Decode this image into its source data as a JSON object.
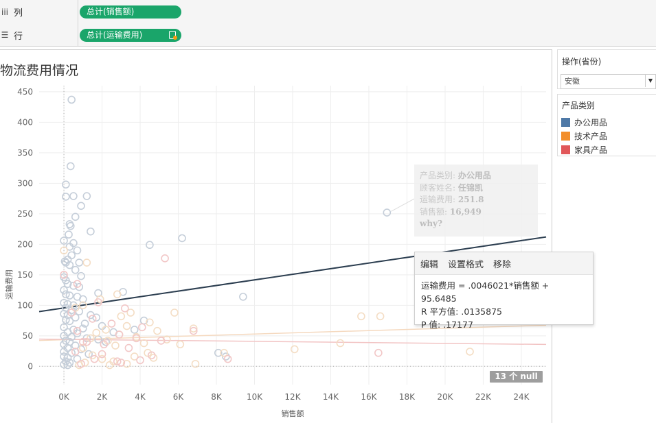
{
  "shelves": {
    "columns": {
      "icon": "columns-icon",
      "label": "列",
      "pill": "总计(销售额)"
    },
    "rows": {
      "icon": "rows-icon",
      "label": "行",
      "pill": "总计(运输费用)",
      "pill_icon": "trend-line-icon"
    }
  },
  "sheet_title": "物流费用情况",
  "filter": {
    "title": "操作(省份)",
    "value": "安徽"
  },
  "legend": {
    "title": "产品类别",
    "items": [
      {
        "label": "办公用品",
        "color": "#4e79a7"
      },
      {
        "label": "技术产品",
        "color": "#f28e2b"
      },
      {
        "label": "家具产品",
        "color": "#e15759"
      }
    ]
  },
  "faded_tooltip": {
    "l1_label": "产品类别:",
    "l1_value": "办公用品",
    "l2_label": "顾客姓名:",
    "l2_value": "任锦凯",
    "l3_label": "运输费用:",
    "l3_value": "251.8",
    "l4_label": "销售额:",
    "l4_value": "16,949",
    "l5": "why?"
  },
  "trend_menu": {
    "actions": [
      "编辑",
      "设置格式",
      "移除"
    ],
    "equation": "运输费用 = .0046021*销售额 + 95.6485",
    "r_squared": "R 平方值: .0135875",
    "p_value": "P 值: .17177"
  },
  "null_badge": "13 个 null",
  "chart_data": {
    "type": "scatter",
    "title": "物流费用情况",
    "xlabel": "销售额",
    "ylabel": "运输费用",
    "xlim": [
      -1300,
      25300
    ],
    "ylim": [
      -30,
      460
    ],
    "x_ticks": [
      0,
      2000,
      4000,
      6000,
      8000,
      10000,
      12000,
      14000,
      16000,
      18000,
      20000,
      22000,
      24000
    ],
    "x_tick_labels": [
      "0K",
      "2K",
      "4K",
      "6K",
      "8K",
      "10K",
      "12K",
      "14K",
      "16K",
      "18K",
      "20K",
      "22K",
      "24K"
    ],
    "y_ticks": [
      0,
      50,
      100,
      150,
      200,
      250,
      300,
      350,
      400,
      450
    ],
    "y_tick_labels": [
      "0",
      "50",
      "100",
      "150",
      "200",
      "250",
      "300",
      "350",
      "400",
      "450"
    ],
    "grid": true,
    "highlighted_point": {
      "series": "办公用品",
      "x": 16949,
      "y": 251.8
    },
    "trend_lines": [
      {
        "series": "办公用品",
        "slope": 0.0046021,
        "intercept": 95.6485,
        "color": "#2c3e50",
        "highlighted": true
      },
      {
        "series": "技术产品",
        "slope": 0.00094,
        "intercept": 43.5,
        "color": "#f5d9bf",
        "highlighted": false
      },
      {
        "series": "家具产品",
        "slope": -0.00033,
        "intercept": 44.2,
        "color": "#f2c4c4",
        "highlighted": false
      }
    ],
    "series": [
      {
        "name": "办公用品",
        "color": "#c5ced9",
        "points": [
          [
            400,
            437
          ],
          [
            350,
            328
          ],
          [
            100,
            298
          ],
          [
            100,
            278
          ],
          [
            500,
            279
          ],
          [
            1200,
            279
          ],
          [
            900,
            263
          ],
          [
            600,
            245
          ],
          [
            300,
            233
          ],
          [
            350,
            230
          ],
          [
            1400,
            221
          ],
          [
            250,
            216
          ],
          [
            0,
            206
          ],
          [
            500,
            202
          ],
          [
            300,
            196
          ],
          [
            700,
            190
          ],
          [
            400,
            182
          ],
          [
            200,
            175
          ],
          [
            50,
            172
          ],
          [
            100,
            170
          ],
          [
            800,
            170
          ],
          [
            300,
            166
          ],
          [
            600,
            158
          ],
          [
            0,
            146
          ],
          [
            100,
            141
          ],
          [
            900,
            148
          ],
          [
            200,
            135
          ],
          [
            500,
            132
          ],
          [
            800,
            130
          ],
          [
            0,
            125
          ],
          [
            100,
            118
          ],
          [
            300,
            116
          ],
          [
            700,
            114
          ],
          [
            1000,
            110
          ],
          [
            0,
            104
          ],
          [
            200,
            102
          ],
          [
            500,
            100
          ],
          [
            100,
            96
          ],
          [
            400,
            92
          ],
          [
            800,
            90
          ],
          [
            0,
            86
          ],
          [
            200,
            84
          ],
          [
            1400,
            84
          ],
          [
            600,
            80
          ],
          [
            1700,
            80
          ],
          [
            100,
            76
          ],
          [
            300,
            74
          ],
          [
            1100,
            70
          ],
          [
            2000,
            66
          ],
          [
            0,
            64
          ],
          [
            500,
            60
          ],
          [
            1000,
            62
          ],
          [
            3700,
            60
          ],
          [
            200,
            56
          ],
          [
            700,
            54
          ],
          [
            2600,
            56
          ],
          [
            0,
            50
          ],
          [
            400,
            48
          ],
          [
            1200,
            46
          ],
          [
            100,
            42
          ],
          [
            300,
            40
          ],
          [
            1800,
            44
          ],
          [
            2200,
            40
          ],
          [
            0,
            36
          ],
          [
            600,
            34
          ],
          [
            200,
            30
          ],
          [
            900,
            28
          ],
          [
            0,
            24
          ],
          [
            400,
            22
          ],
          [
            1300,
            20
          ],
          [
            0,
            16
          ],
          [
            200,
            14
          ],
          [
            700,
            12
          ],
          [
            100,
            8
          ],
          [
            300,
            6
          ],
          [
            0,
            3
          ],
          [
            200,
            2
          ],
          [
            4500,
            199
          ],
          [
            6200,
            210
          ],
          [
            9400,
            114
          ],
          [
            3100,
            122
          ],
          [
            1800,
            120
          ],
          [
            4200,
            75
          ],
          [
            16949,
            252
          ],
          [
            8100,
            22
          ],
          [
            8500,
            16
          ]
        ]
      },
      {
        "name": "技术产品",
        "color": "#f4ddc4",
        "points": [
          [
            1200,
            170
          ],
          [
            0,
            190
          ],
          [
            2800,
            118
          ],
          [
            1900,
            110
          ],
          [
            1000,
            100
          ],
          [
            600,
            96
          ],
          [
            3500,
            88
          ],
          [
            5800,
            88
          ],
          [
            3000,
            82
          ],
          [
            4500,
            72
          ],
          [
            3300,
            66
          ],
          [
            2200,
            60
          ],
          [
            4900,
            58
          ],
          [
            6800,
            62
          ],
          [
            1700,
            55
          ],
          [
            2900,
            52
          ],
          [
            3800,
            48
          ],
          [
            1400,
            46
          ],
          [
            2300,
            42
          ],
          [
            5400,
            44
          ],
          [
            4200,
            38
          ],
          [
            6100,
            36
          ],
          [
            2700,
            34
          ],
          [
            1000,
            30
          ],
          [
            4400,
            22
          ],
          [
            1500,
            18
          ],
          [
            3700,
            16
          ],
          [
            2000,
            12
          ],
          [
            2600,
            8
          ],
          [
            1100,
            6
          ],
          [
            3300,
            4
          ],
          [
            800,
            2
          ],
          [
            2400,
            2
          ],
          [
            4700,
            14
          ],
          [
            6900,
            4
          ],
          [
            12100,
            28
          ],
          [
            14500,
            38
          ],
          [
            15600,
            82
          ],
          [
            16600,
            82
          ],
          [
            21300,
            24
          ],
          [
            8400,
            22
          ]
        ]
      },
      {
        "name": "家具产品",
        "color": "#f2c7c7",
        "points": [
          [
            5300,
            177
          ],
          [
            0,
            150
          ],
          [
            700,
            135
          ],
          [
            1800,
            105
          ],
          [
            3200,
            95
          ],
          [
            400,
            88
          ],
          [
            1500,
            78
          ],
          [
            2500,
            70
          ],
          [
            4100,
            64
          ],
          [
            700,
            58
          ],
          [
            2900,
            52
          ],
          [
            3800,
            46
          ],
          [
            1200,
            40
          ],
          [
            5100,
            42
          ],
          [
            2100,
            36
          ],
          [
            3400,
            30
          ],
          [
            600,
            24
          ],
          [
            4600,
            18
          ],
          [
            1600,
            12
          ],
          [
            2800,
            8
          ],
          [
            900,
            4
          ],
          [
            4000,
            10
          ],
          [
            6800,
            58
          ],
          [
            8600,
            12
          ],
          [
            16500,
            22
          ],
          [
            1000,
            40
          ],
          [
            2000,
            20
          ],
          [
            3000,
            6
          ]
        ]
      }
    ]
  }
}
